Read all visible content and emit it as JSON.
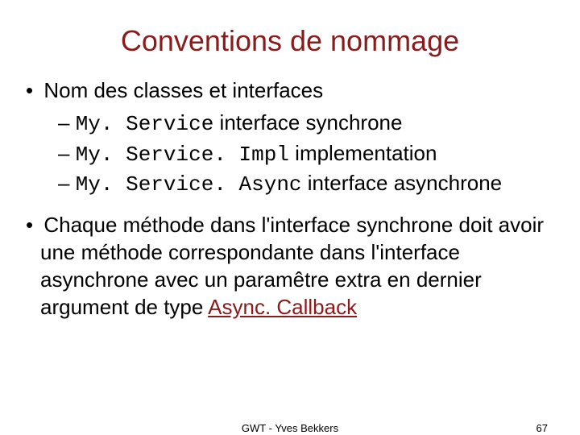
{
  "title": "Conventions de nommage",
  "bullets": {
    "b1": "Nom des classes et interfaces",
    "sub": [
      {
        "code": "My. Service",
        "desc": " interface synchrone"
      },
      {
        "code": "My. Service. Impl",
        "desc": " implementation"
      },
      {
        "code": "My. Service. Async",
        "desc": " interface asynchrone"
      }
    ],
    "b2_part1": "Chaque méthode dans l'interface synchrone doit avoir une méthode correspondante dans l'interface asynchrone avec un paramêtre extra en dernier argument de type ",
    "b2_link": "Async. Callback"
  },
  "footer": {
    "center": "GWT - Yves Bekkers",
    "page": "67"
  }
}
